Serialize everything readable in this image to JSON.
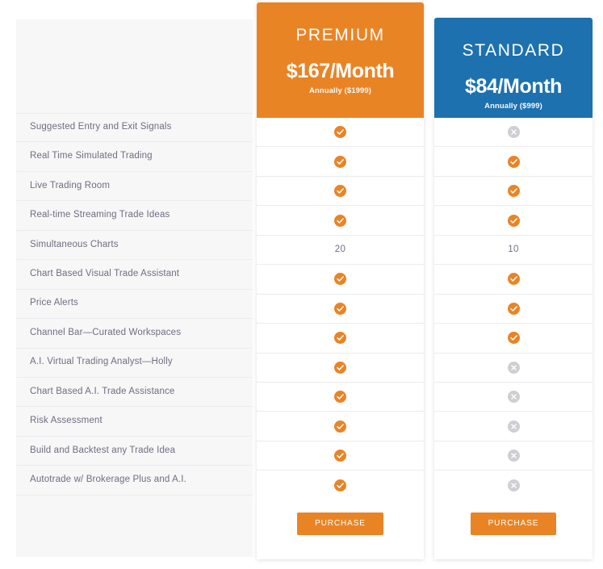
{
  "features": [
    "Suggested Entry and Exit Signals",
    "Real Time Simulated Trading",
    "Live Trading Room",
    "Real-time Streaming Trade Ideas",
    "Simultaneous Charts",
    "Chart Based Visual Trade Assistant",
    "Price Alerts",
    "Channel Bar—Curated Workspaces",
    "A.I. Virtual Trading Analyst—Holly",
    "Chart Based A.I. Trade Assistance",
    "Risk Assessment",
    "Build and Backtest any Trade Idea",
    "Autotrade w/ Brokerage Plus and A.I."
  ],
  "plans": [
    {
      "name": "PREMIUM",
      "price": "$167/Month",
      "annual": "Annually ($1999)",
      "header_color": "#e98425",
      "purchase_label": "PURCHASE",
      "values": [
        "check",
        "check",
        "check",
        "check",
        "20",
        "check",
        "check",
        "check",
        "check",
        "check",
        "check",
        "check",
        "check"
      ]
    },
    {
      "name": "STANDARD",
      "price": "$84/Month",
      "annual": "Annually ($999)",
      "header_color": "#1d71ae",
      "purchase_label": "PURCHASE",
      "values": [
        "cross",
        "check",
        "check",
        "check",
        "10",
        "check",
        "check",
        "check",
        "cross",
        "cross",
        "cross",
        "cross",
        "cross"
      ]
    }
  ],
  "colors": {
    "accent_orange": "#e98425",
    "accent_blue": "#1d71ae",
    "check_icon": "#e98425",
    "cross_icon": "#cfcfd3",
    "panel_background": "#f7f7f8",
    "text": "#6e6e80"
  }
}
